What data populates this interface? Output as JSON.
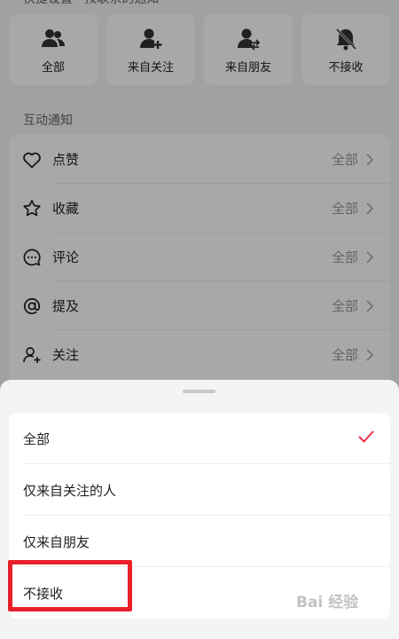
{
  "quick_settings": {
    "title": "快捷设置 · 按联系的通知",
    "cards": [
      {
        "label": "全部",
        "icon": "group-icon"
      },
      {
        "label": "来自关注",
        "icon": "add-user-icon"
      },
      {
        "label": "来自朋友",
        "icon": "friend-icon"
      },
      {
        "label": "不接收",
        "icon": "bell-off-icon"
      }
    ]
  },
  "interaction": {
    "title": "互动通知",
    "rows": [
      {
        "label": "点赞",
        "value": "全部",
        "icon": "heart-icon"
      },
      {
        "label": "收藏",
        "value": "全部",
        "icon": "star-icon"
      },
      {
        "label": "评论",
        "value": "全部",
        "icon": "comment-icon"
      },
      {
        "label": "提及",
        "value": "全部",
        "icon": "at-icon"
      },
      {
        "label": "关注",
        "value": "全部",
        "icon": "follow-icon"
      }
    ]
  },
  "sheet": {
    "options": [
      {
        "label": "全部",
        "selected": true
      },
      {
        "label": "仅来自关注的人",
        "selected": false
      },
      {
        "label": "仅来自朋友",
        "selected": false
      },
      {
        "label": "不接收",
        "selected": false
      }
    ],
    "check_color": "#e8304a"
  },
  "annotation": {
    "color": "#e8202a"
  },
  "watermark": "Bai 经验"
}
